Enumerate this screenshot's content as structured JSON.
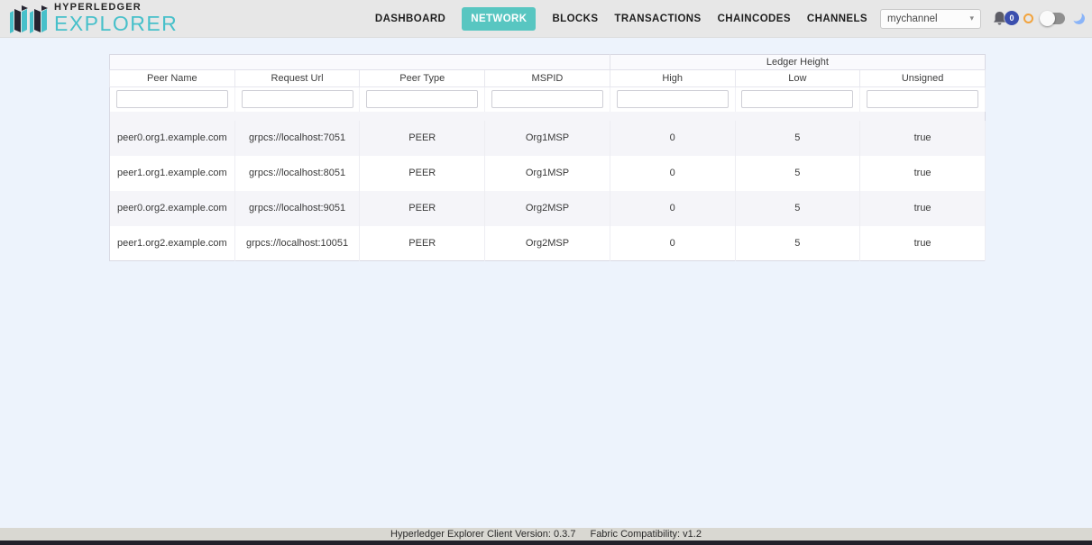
{
  "header": {
    "logo": {
      "top": "HYPERLEDGER",
      "bottom": "EXPLORER"
    },
    "nav": [
      {
        "label": "DASHBOARD",
        "active": false
      },
      {
        "label": "NETWORK",
        "active": true
      },
      {
        "label": "BLOCKS",
        "active": false
      },
      {
        "label": "TRANSACTIONS",
        "active": false
      },
      {
        "label": "CHAINCODES",
        "active": false
      },
      {
        "label": "CHANNELS",
        "active": false
      }
    ],
    "channel_select": {
      "value": "mychannel"
    },
    "notifications": {
      "count": "0"
    },
    "icons": [
      "bell-icon",
      "sun-icon",
      "theme-toggle",
      "moon-icon"
    ]
  },
  "table": {
    "group_header": {
      "label": "Ledger Height"
    },
    "columns": [
      "Peer Name",
      "Request Url",
      "Peer Type",
      "MSPID",
      "High",
      "Low",
      "Unsigned"
    ],
    "filters": [
      "",
      "",
      "",
      "",
      "",
      "",
      ""
    ],
    "rows": [
      [
        "peer0.org1.example.com",
        "grpcs://localhost:7051",
        "PEER",
        "Org1MSP",
        "0",
        "5",
        "true"
      ],
      [
        "peer1.org1.example.com",
        "grpcs://localhost:8051",
        "PEER",
        "Org1MSP",
        "0",
        "5",
        "true"
      ],
      [
        "peer0.org2.example.com",
        "grpcs://localhost:9051",
        "PEER",
        "Org2MSP",
        "0",
        "5",
        "true"
      ],
      [
        "peer1.org2.example.com",
        "grpcs://localhost:10051",
        "PEER",
        "Org2MSP",
        "0",
        "5",
        "true"
      ]
    ]
  },
  "footer": {
    "version_text": "Hyperledger Explorer Client Version: 0.3.7",
    "compat_text": "Fabric Compatibility: v1.2"
  },
  "colors": {
    "accent_teal": "#58c6c1",
    "logo_teal": "#47c0ca",
    "badge_blue": "#3b4fae",
    "sun_orange": "#f2a33c",
    "moon_blue": "#8ab4f8",
    "page_bg": "#edf3fc",
    "header_bg": "#e7e7e7",
    "row_stripe": "#f5f5f9",
    "footer_bg": "#d9d8d2"
  }
}
